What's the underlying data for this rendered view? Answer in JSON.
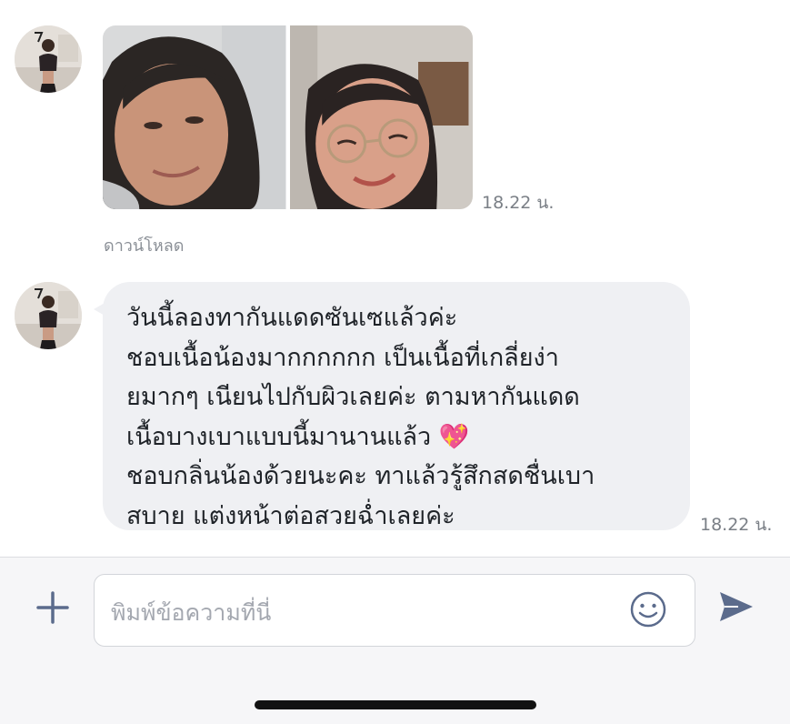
{
  "messages": [
    {
      "type": "images",
      "image_count": 2,
      "time": "18.22 น.",
      "download_label": "ดาวน์โหลด"
    },
    {
      "type": "text",
      "lines": [
        "วันนี้ลองทากันแดดซันเซแล้วค่ะ",
        "ชอบเนื้อน้องมากกกกกก เป็นเนื้อที่เกลี่ยง่า",
        "ยมากๆ เนียนไปกับผิวเลยค่ะ ตามหากันแดด",
        "เนื้อบางเบาแบบนี้มานานแล้ว 💖",
        "ชอบกลิ่นน้องด้วยนะคะ ทาแล้วรู้สึกสดชื่นเบา",
        "สบาย แต่งหน้าต่อสวยฉ่ำเลยค่ะ"
      ],
      "time": "18.22 น."
    }
  ],
  "input": {
    "placeholder": "พิมพ์ข้อความที่นี่"
  },
  "icons": {
    "add": "plus-icon",
    "emoji": "smiley-icon",
    "send": "send-arrow-icon"
  },
  "colors": {
    "bubble": "#eff0f3",
    "icon_accent": "#5b6b8c",
    "timestamp": "#7a7f86"
  }
}
